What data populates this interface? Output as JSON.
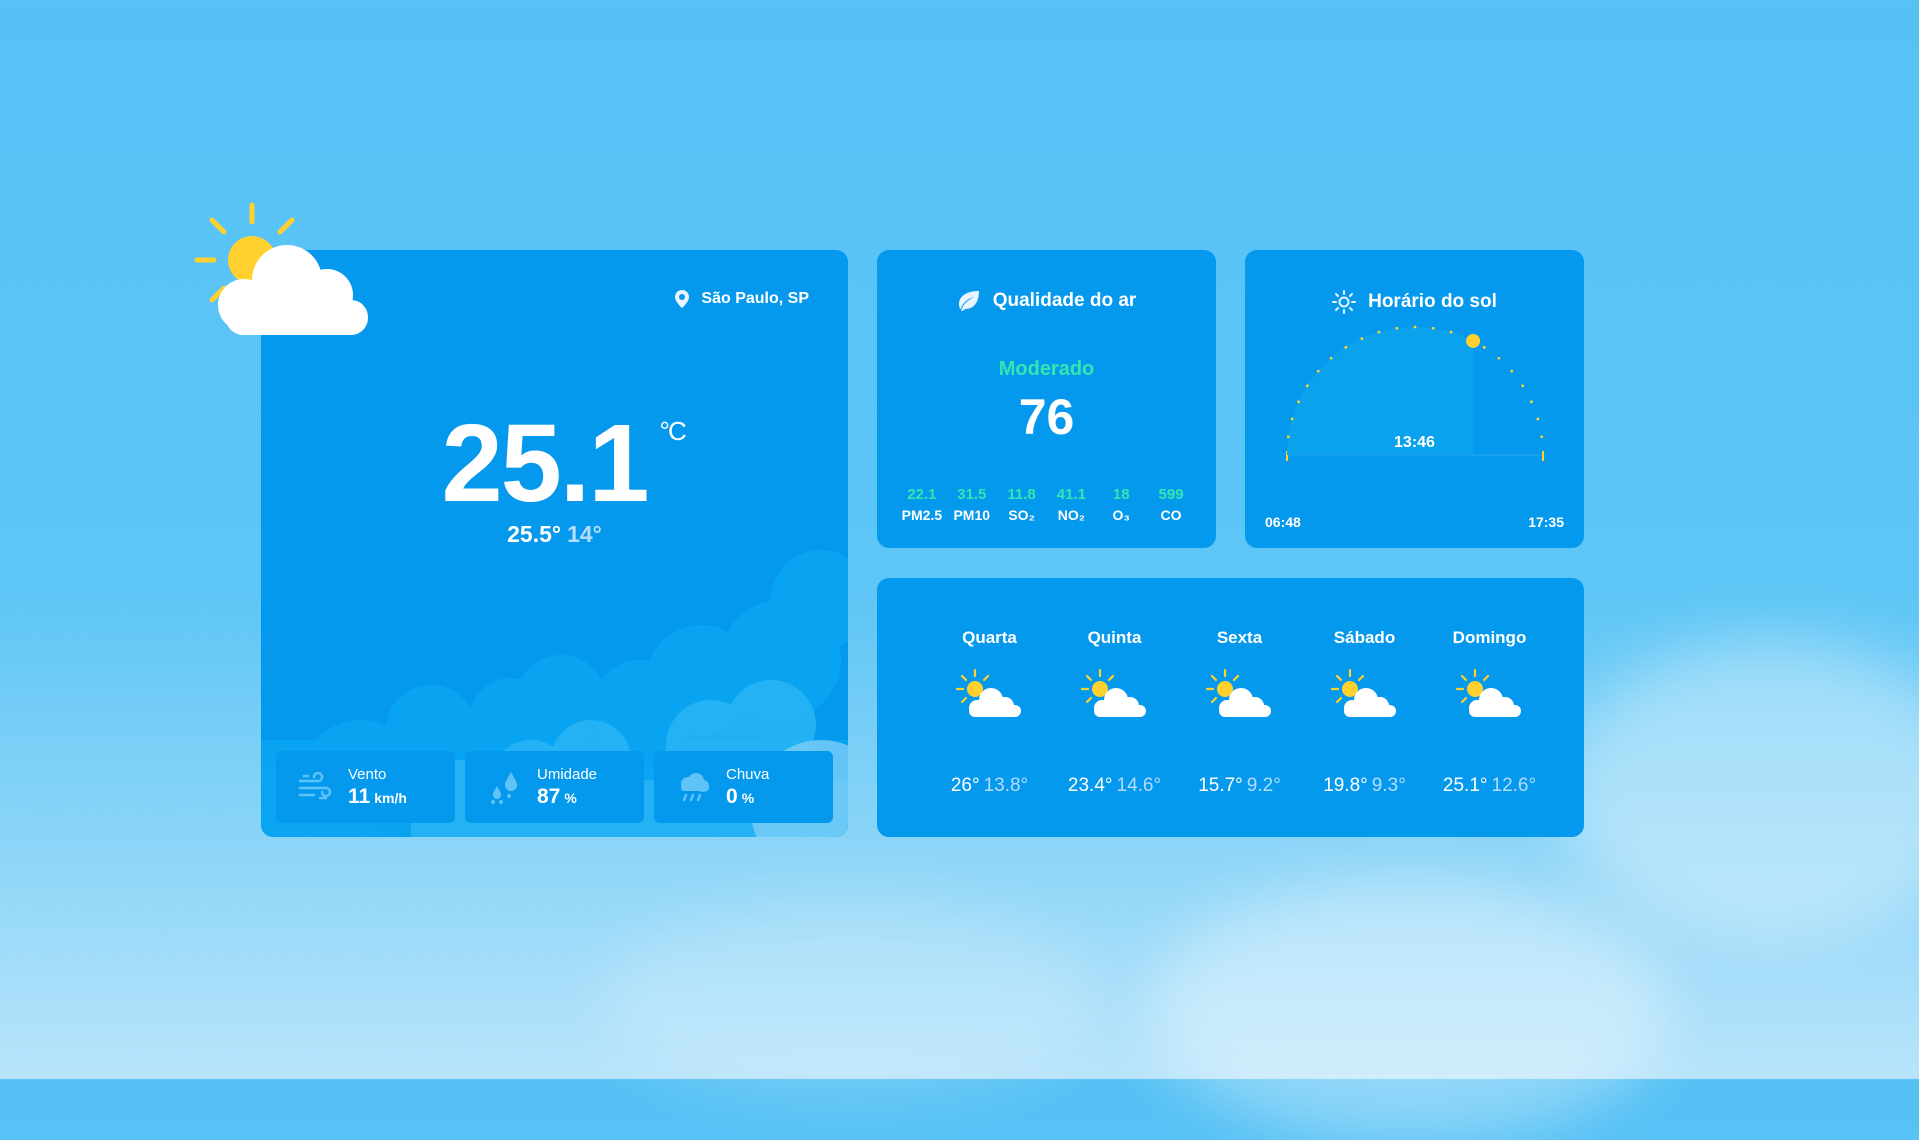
{
  "location": {
    "name": "São Paulo, SP",
    "icon": "pin-icon"
  },
  "current": {
    "temp": "25.1",
    "unit": "°C",
    "max": "25.5°",
    "min": "14°",
    "icon": "sun-cloud-icon"
  },
  "stats": [
    {
      "label": "Vento",
      "value": "11",
      "unit": "km/h",
      "icon": "wind-icon"
    },
    {
      "label": "Umidade",
      "value": "87",
      "unit": "%",
      "icon": "humidity-icon"
    },
    {
      "label": "Chuva",
      "value": "0",
      "unit": "%",
      "icon": "rain-icon"
    }
  ],
  "air_quality": {
    "title": "Qualidade do ar",
    "icon": "leaf-icon",
    "status": "Moderado",
    "value": "76",
    "pollutants": [
      {
        "value": "22.1",
        "name": "PM2.5"
      },
      {
        "value": "31.5",
        "name": "PM10"
      },
      {
        "value": "11.8",
        "name": "SO₂"
      },
      {
        "value": "41.1",
        "name": "NO₂"
      },
      {
        "value": "18",
        "name": "O₃"
      },
      {
        "value": "599",
        "name": "CO"
      }
    ]
  },
  "sun": {
    "title": "Horário do sol",
    "icon": "sun-icon",
    "sunrise": "06:48",
    "sunset": "17:35",
    "now": "13:46",
    "progress": 0.65
  },
  "forecast": [
    {
      "day": "Quarta",
      "max": "26°",
      "min": "13.8°",
      "icon": "sun-cloud-icon"
    },
    {
      "day": "Quinta",
      "max": "23.4°",
      "min": "14.6°",
      "icon": "sun-cloud-icon"
    },
    {
      "day": "Sexta",
      "max": "15.7°",
      "min": "9.2°",
      "icon": "sun-cloud-icon"
    },
    {
      "day": "Sábado",
      "max": "19.8°",
      "min": "9.3°",
      "icon": "sun-cloud-icon"
    },
    {
      "day": "Domingo",
      "max": "25.1°",
      "min": "12.6°",
      "icon": "sun-cloud-icon"
    }
  ],
  "colors": {
    "card": "#0599ee",
    "accent_green": "#33e6b0",
    "sun_yellow": "#ffd02e",
    "min_temp": "#b6dcff"
  }
}
